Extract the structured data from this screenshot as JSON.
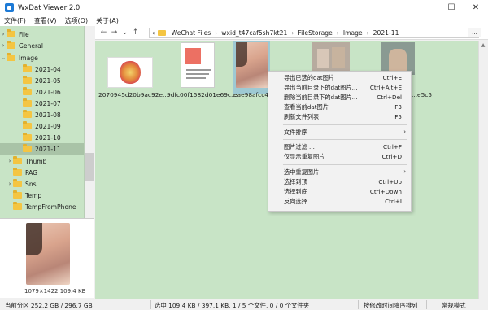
{
  "window": {
    "title": "WxDat Viewer 2.0",
    "minimize": "─",
    "maximize": "☐",
    "close": "✕"
  },
  "menu": [
    "文件(F)",
    "查看(V)",
    "选项(O)",
    "关于(A)"
  ],
  "tree": {
    "items": [
      {
        "label": "File",
        "expandable": true,
        "expanded": false
      },
      {
        "label": "General",
        "expandable": true,
        "expanded": false
      },
      {
        "label": "Image",
        "expandable": true,
        "expanded": true
      },
      {
        "label": "2021-04"
      },
      {
        "label": "2021-05"
      },
      {
        "label": "2021-06"
      },
      {
        "label": "2021-07"
      },
      {
        "label": "2021-08"
      },
      {
        "label": "2021-09"
      },
      {
        "label": "2021-10"
      },
      {
        "label": "2021-11",
        "selected": true
      },
      {
        "label": "Thumb",
        "expandable": true,
        "expanded": false
      },
      {
        "label": "PAG"
      },
      {
        "label": "Sns",
        "expandable": true,
        "expanded": false
      },
      {
        "label": "Temp"
      },
      {
        "label": "TempFromPhone"
      }
    ]
  },
  "preview": {
    "info": "1079×1422  109.4 KB"
  },
  "nav": {
    "back": "←",
    "forward": "→",
    "down": "⌄",
    "up": "↑",
    "chevrons": "«",
    "breadcrumb": [
      "WeChat Files",
      "wxid_t47caf5sh7kt21",
      "FileStorage",
      "Image",
      "2021-11"
    ],
    "more": "..."
  },
  "files": [
    {
      "label": "2070945d20b9ac92e..."
    },
    {
      "label": "9dfc00f1582d01e69c..."
    },
    {
      "label": "eae98afcc47"
    },
    {
      "label": ""
    },
    {
      "label": "...e5c5"
    }
  ],
  "context_menu": {
    "items": [
      {
        "label": "导出已选的dat图片",
        "shortcut": "Ctrl+E"
      },
      {
        "label": "导出当前目录下的dat图片...",
        "shortcut": "Ctrl+Alt+E"
      },
      {
        "label": "删除当前目录下的dat图片...",
        "shortcut": "Ctrl+Del"
      },
      {
        "label": "查看当前dat图片",
        "shortcut": "F3"
      },
      {
        "label": "刷新文件列表",
        "shortcut": "F5"
      },
      {
        "label": "文件排序",
        "submenu": true
      },
      {
        "label": "图片过滤 ...",
        "shortcut": "Ctrl+F"
      },
      {
        "label": "仅显示重复图片",
        "shortcut": "Ctrl+D"
      },
      {
        "label": "选中重复图片",
        "submenu": true
      },
      {
        "label": "选择到顶",
        "shortcut": "Ctrl+Up"
      },
      {
        "label": "选择到底",
        "shortcut": "Ctrl+Down"
      },
      {
        "label": "反向选择",
        "shortcut": "Ctrl+I"
      }
    ]
  },
  "status": {
    "partition": "当前分区 252.2 GB / 296.7 GB",
    "selection": "选中 109.4 KB / 397.1 KB,  1 / 5 个文件, 0 / 0 个文件夹",
    "sort": "按修改时间降序排列",
    "mode": "常规模式"
  },
  "colors": {
    "panel_bg": "#c8e4c6",
    "selected_tree": "#a9c3a7",
    "folder": "#f4c542"
  }
}
